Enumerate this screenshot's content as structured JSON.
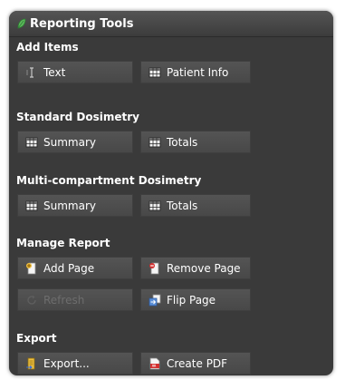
{
  "panel": {
    "title": "Reporting Tools"
  },
  "sections": {
    "add_items": {
      "label": "Add Items",
      "text_button": "Text",
      "patient_info_button": "Patient Info"
    },
    "standard_dosimetry": {
      "label": "Standard Dosimetry",
      "summary_button": "Summary",
      "totals_button": "Totals"
    },
    "multi_compartment_dosimetry": {
      "label": "Multi-compartment Dosimetry",
      "summary_button": "Summary",
      "totals_button": "Totals"
    },
    "manage_report": {
      "label": "Manage Report",
      "add_page_button": "Add Page",
      "remove_page_button": "Remove Page",
      "refresh_button": "Refresh",
      "flip_page_button": "Flip Page"
    },
    "export": {
      "label": "Export",
      "export_button": "Export...",
      "create_pdf_button": "Create PDF"
    }
  },
  "colors": {
    "panel_bg": "#3a3a3a",
    "button_bg": "#4e4e4e",
    "text": "#ffffff",
    "disabled_text": "#6d6d6d",
    "accent_green": "#4caf50",
    "pdf_red": "#d32f2f"
  },
  "icons": {
    "title": "leaf-icon",
    "text": "text-cursor-icon",
    "table": "table-icon",
    "add_page": "add-page-icon",
    "remove_page": "remove-page-icon",
    "refresh": "refresh-icon",
    "flip_page": "flip-page-icon",
    "export": "export-icon",
    "pdf": "pdf-icon"
  }
}
